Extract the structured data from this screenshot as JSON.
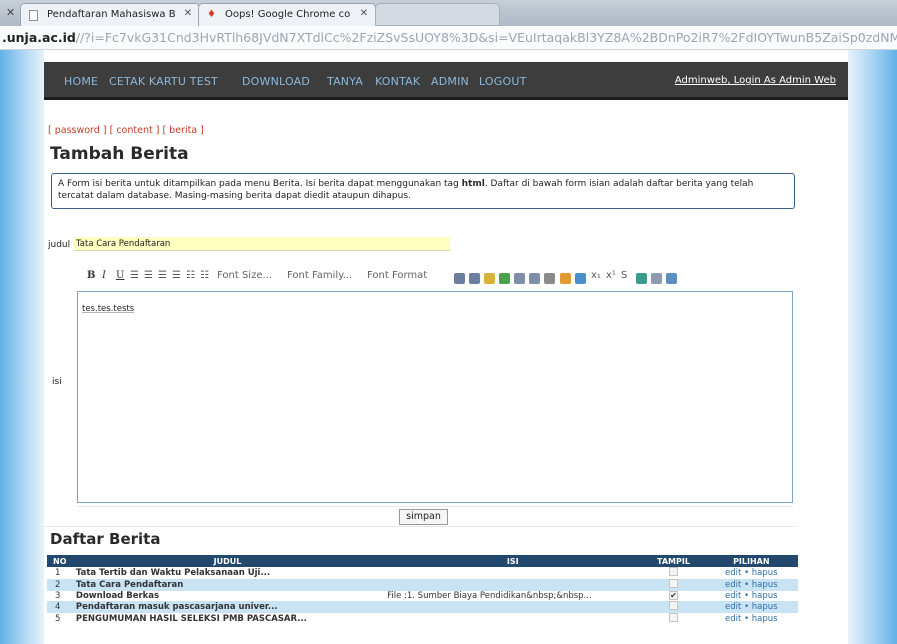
{
  "browser": {
    "tabs": [
      {
        "label": "Pendaftaran Mahasiswa B"
      },
      {
        "label": "Oops! Google Chrome co"
      }
    ],
    "url_host": ".unja.ac.id",
    "url_rest": "//?i=Fc7vkG31Cnd3HvRTlh68JVdN7XTdlCc%2FziZSvSsUOY8%3D&si=VEuIrtaqakBl3YZ8A%2BDnPo2iR7%2FdIOYTwunB5ZaiSp0zdNM"
  },
  "nav": {
    "items": [
      "HOME",
      "CETAK KARTU TEST",
      "DOWNLOAD",
      "TANYA",
      "KONTAK",
      "ADMIN",
      "LOGOUT"
    ],
    "admin_info": "Adminweb, Login As Admin Web"
  },
  "breadcrumb": {
    "password": "[ password ]",
    "content": "[ content ]",
    "berita": "[ berita ]"
  },
  "page_title": "Tambah Berita",
  "info": {
    "before": "A Form isi berita untuk ditampilkan pada menu Berita. Isi berita dapat menggunakan tag ",
    "tag": "html",
    "after": ". Daftar di bawah form isian adalah daftar berita yang telah tercatat dalam database. Masing-masing berita dapat diedit ataupun dihapus."
  },
  "form": {
    "judul_label": "judul",
    "judul_value": "Tata Cara Pendaftaran",
    "isi_label": "isi",
    "isi_value": "tes.tes.tests",
    "toolbar": {
      "bold": "B",
      "italic": "I",
      "underline": "U",
      "font_size": "Font Size...",
      "font_family": "Font Family...",
      "font_format": "Font Format"
    },
    "submit_label": "simpan"
  },
  "list": {
    "title": "Daftar Berita",
    "headers": {
      "no": "NO",
      "judul": "JUDUL",
      "isi": "ISI",
      "tampil": "TAMPIL",
      "pilihan": "PILIHAN"
    },
    "edit_label": "edit",
    "sep": "•",
    "hapus_label": "hapus",
    "rows": [
      {
        "no": "1",
        "judul": "Tata Tertib dan Waktu Pelaksanaan Uji...",
        "isi": "",
        "tampil": false
      },
      {
        "no": "2",
        "judul": "Tata Cara Pendaftaran",
        "isi": "",
        "tampil": false
      },
      {
        "no": "3",
        "judul": "Download Berkas",
        "isi": "File :1. Sumber Biaya Pendidikan&nbsp;&nbsp...",
        "tampil": true
      },
      {
        "no": "4",
        "judul": "Pendaftaran masuk pascasarjana univer...",
        "isi": "",
        "tampil": false
      },
      {
        "no": "5",
        "judul": "PENGUMUMAN HASIL SELEKSI PMB PASCASAR...",
        "isi": "",
        "tampil": false
      }
    ]
  }
}
